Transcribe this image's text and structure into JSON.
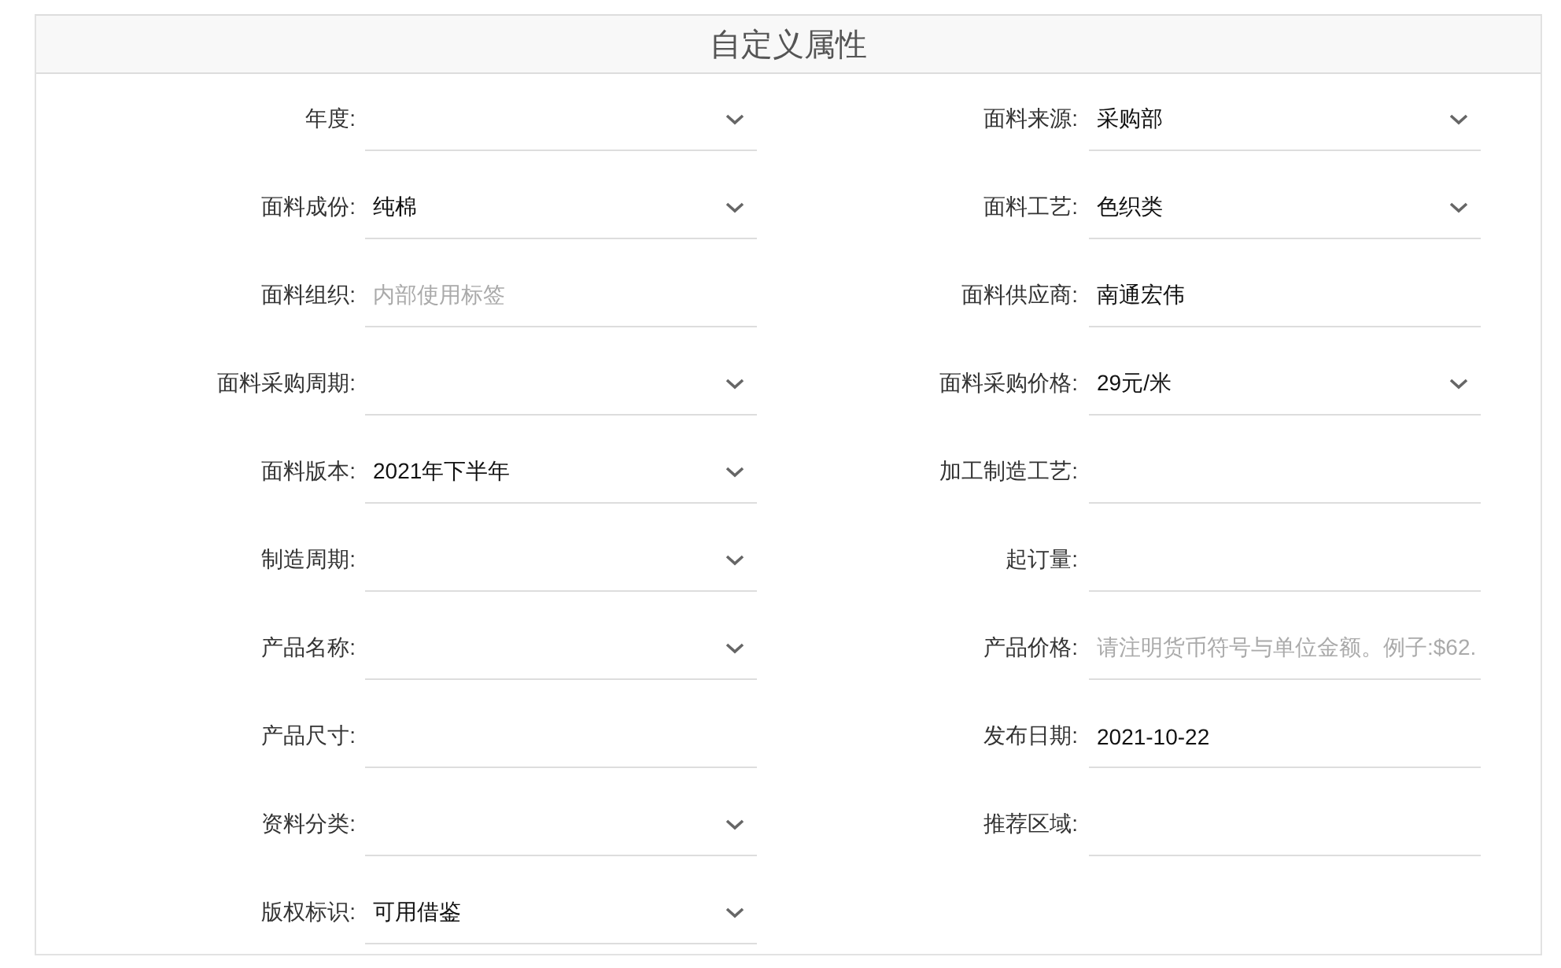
{
  "title": "自定义属性",
  "fields": [
    {
      "label": "年度:",
      "kind": "select"
    },
    {
      "label": "面料来源:",
      "kind": "select",
      "value": "采购部"
    },
    {
      "label": "面料成份:",
      "kind": "select",
      "value": "纯棉"
    },
    {
      "label": "面料工艺:",
      "kind": "select",
      "value": "色织类"
    },
    {
      "label": "面料组织:",
      "kind": "text",
      "placeholder": "内部使用标签"
    },
    {
      "label": "面料供应商:",
      "kind": "text",
      "value": "南通宏伟"
    },
    {
      "label": "面料采购周期:",
      "kind": "select"
    },
    {
      "label": "面料采购价格:",
      "kind": "select",
      "value": "29元/米"
    },
    {
      "label": "面料版本:",
      "kind": "select",
      "value": "2021年下半年"
    },
    {
      "label": "加工制造工艺:",
      "kind": "text"
    },
    {
      "label": "制造周期:",
      "kind": "select"
    },
    {
      "label": "起订量:",
      "kind": "text"
    },
    {
      "label": "产品名称:",
      "kind": "select"
    },
    {
      "label": "产品价格:",
      "kind": "text",
      "placeholder": "请注明货币符号与单位金额。例子:$62."
    },
    {
      "label": "产品尺寸:",
      "kind": "text"
    },
    {
      "label": "发布日期:",
      "kind": "text",
      "value": "2021-10-22"
    },
    {
      "label": "资料分类:",
      "kind": "select"
    },
    {
      "label": "推荐区域:",
      "kind": "text"
    },
    {
      "label": "版权标识:",
      "kind": "select",
      "value": "可用借鉴"
    }
  ]
}
